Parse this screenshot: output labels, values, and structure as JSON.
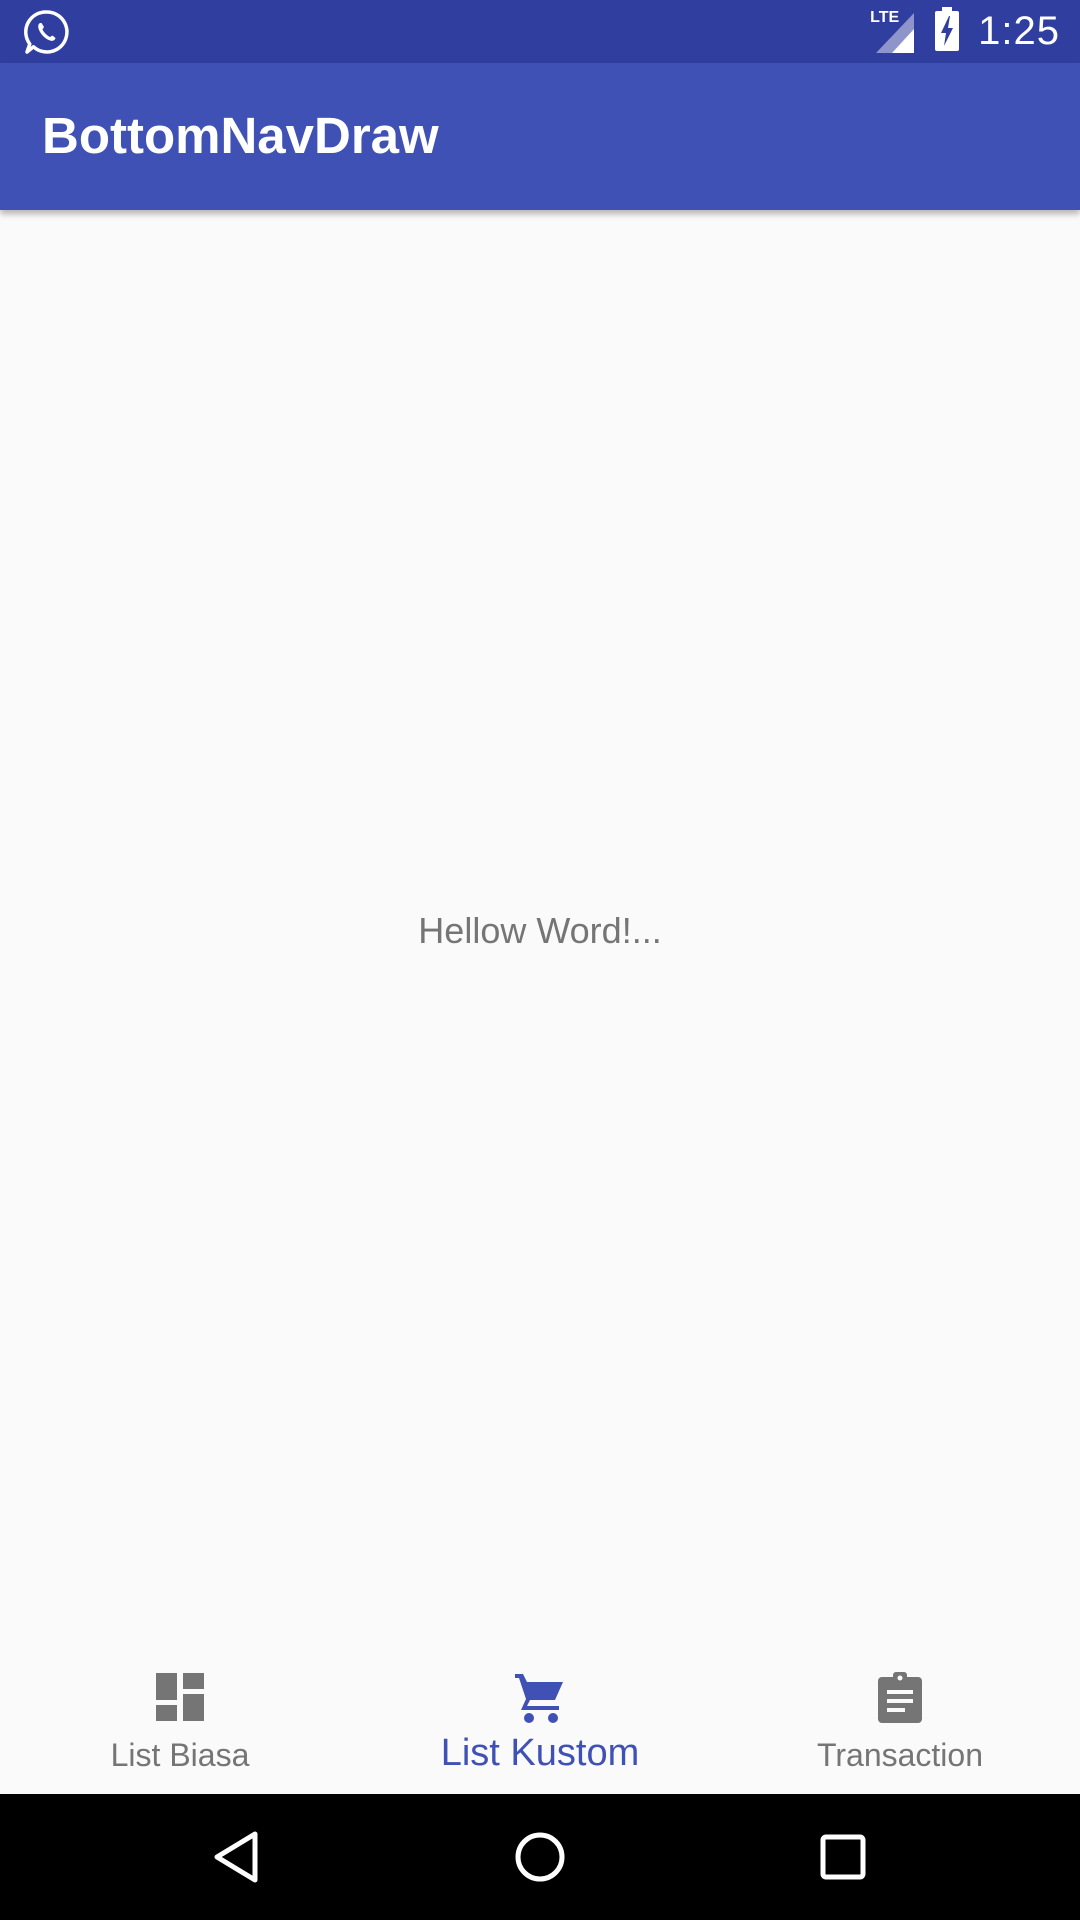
{
  "status_bar": {
    "time": "1:25",
    "network_label": "LTE",
    "left_icon": "whatsapp-icon",
    "icons": [
      "lte-signal-icon",
      "battery-charging-icon"
    ]
  },
  "app_bar": {
    "title": "BottomNavDraw"
  },
  "main": {
    "message": "Hellow Word!..."
  },
  "bottom_nav": {
    "items": [
      {
        "label": "List Biasa",
        "icon": "dashboard-icon",
        "active": false
      },
      {
        "label": "List Kustom",
        "icon": "shopping-cart-icon",
        "active": true
      },
      {
        "label": "Transaction",
        "icon": "clipboard-icon",
        "active": false
      }
    ]
  },
  "system_nav": {
    "buttons": [
      "back-icon",
      "home-icon",
      "recents-icon"
    ]
  },
  "colors": {
    "status_bar": "#303f9f",
    "app_bar": "#3f51b5",
    "accent": "#3f51b5",
    "inactive": "#757575",
    "background": "#fafafa"
  }
}
